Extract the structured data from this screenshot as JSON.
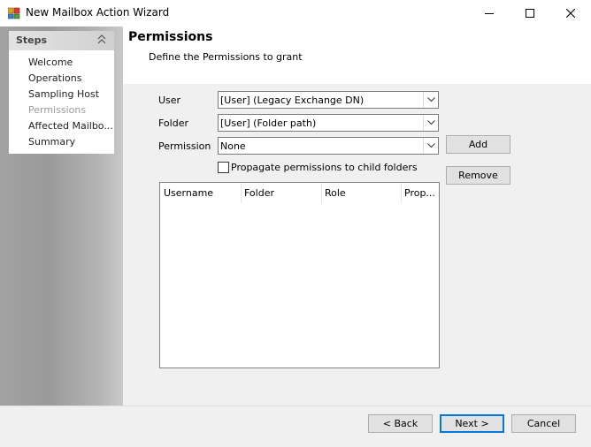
{
  "window": {
    "title": "New Mailbox Action Wizard",
    "controls": [
      "minimize-icon",
      "maximize-icon",
      "close-icon"
    ]
  },
  "steps": {
    "title": "Steps",
    "items": [
      {
        "label": "Welcome",
        "active": false
      },
      {
        "label": "Operations",
        "active": false
      },
      {
        "label": "Sampling Host",
        "active": false
      },
      {
        "label": "Permissions",
        "active": true
      },
      {
        "label": "Affected Mailbo...",
        "active": false
      },
      {
        "label": "Summary",
        "active": false
      }
    ]
  },
  "header": {
    "title": "Permissions",
    "subtitle": "Define the Permissions to grant"
  },
  "form": {
    "user": {
      "label": "User",
      "value": "[User] (Legacy Exchange DN)"
    },
    "folder": {
      "label": "Folder",
      "value": "[User] (Folder path)"
    },
    "permission": {
      "label": "Permission",
      "value": "None"
    },
    "propagate": {
      "label": "Propagate permissions to child folders",
      "checked": false
    },
    "add_label": "Add",
    "remove_label": "Remove"
  },
  "grid": {
    "columns": [
      "Username",
      "Folder",
      "Role",
      "Prop..."
    ],
    "rows": []
  },
  "footer": {
    "back_label": "< Back",
    "next_label": "Next >",
    "cancel_label": "Cancel"
  },
  "colors": {
    "accent": "#0078d7",
    "window_bg": "#f0f0f0"
  }
}
